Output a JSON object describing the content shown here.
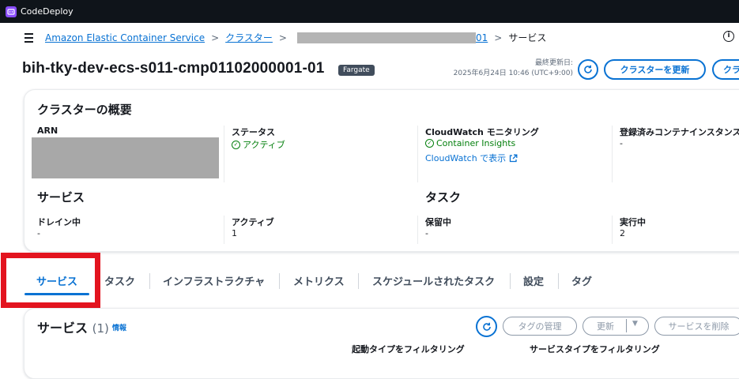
{
  "topbar": {
    "app_name": "CodeDeploy",
    "icon": "codedeploy-icon"
  },
  "breadcrumb": {
    "menu_icon": "hamburger-icon",
    "items": [
      {
        "label": "Amazon Elastic Container Service",
        "link": true
      },
      {
        "label": "クラスター",
        "link": true
      },
      {
        "label": "01",
        "link": true,
        "redacted_prefix": true
      },
      {
        "label": "サービス",
        "link": false
      }
    ],
    "info_icon": "info-icon"
  },
  "header": {
    "title": "bih-tky-dev-ecs-s011-cmp01102000001-01",
    "badge": "Fargate",
    "last_updated_label": "最終更新日:",
    "last_updated_value": "2025年6月24日 10:46 (UTC+9:00)",
    "refresh_icon": "refresh-icon",
    "update_cluster_button": "クラスターを更新",
    "truncated_button": "クラ"
  },
  "overview": {
    "title": "クラスターの概要",
    "arn_label": "ARN",
    "status_label": "ステータス",
    "status_value": "アクティブ",
    "cloudwatch_label": "CloudWatch モニタリング",
    "container_insights": "Container Insights",
    "cloudwatch_link": "CloudWatch で表示",
    "registered_label": "登録済みコンテナインスタンス",
    "registered_value": "-",
    "services_title": "サービス",
    "draining_label": "ドレイン中",
    "draining_value": "-",
    "active_label": "アクティブ",
    "active_value": "1",
    "tasks_title": "タスク",
    "pending_label": "保留中",
    "pending_value": "-",
    "running_label": "実行中",
    "running_value": "2"
  },
  "tabs": [
    {
      "label": "サービス",
      "active": true
    },
    {
      "label": "タスク",
      "active": false
    },
    {
      "label": "インフラストラクチャ",
      "active": false
    },
    {
      "label": "メトリクス",
      "active": false
    },
    {
      "label": "スケジュールされたタスク",
      "active": false
    },
    {
      "label": "設定",
      "active": false
    },
    {
      "label": "タグ",
      "active": false
    }
  ],
  "services_panel": {
    "title": "サービス",
    "count": "(1)",
    "info": "情報",
    "manage_tags_button": "タグの管理",
    "update_button": "更新",
    "delete_button": "サービスを削除",
    "filter_launch_type": "起動タイプをフィルタリング",
    "filter_service_type": "サービスタイプをフィルタリング"
  },
  "colors": {
    "accent": "#0972d3",
    "success": "#037f0c",
    "topbar": "#0f141a",
    "highlight_box": "#e3141f"
  }
}
